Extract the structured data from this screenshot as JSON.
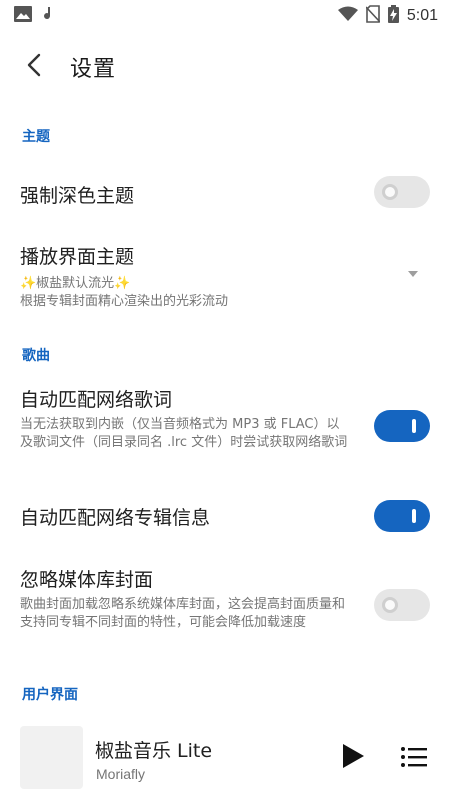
{
  "status_bar": {
    "time": "5:01",
    "icons": [
      "image-icon",
      "music-note-icon",
      "wifi-icon",
      "no-sim-icon",
      "battery-charging-icon"
    ]
  },
  "app_bar": {
    "title": "设置",
    "back_icon": "chevron-left-icon"
  },
  "sections": {
    "theme": "主题",
    "lyrics": "歌曲",
    "ui": "用户界面"
  },
  "prefs": {
    "force_dark": {
      "title": "强制深色主题",
      "enabled": false
    },
    "player_theme": {
      "title": "播放界面主题",
      "value": "✨椒盐默认流光✨",
      "summary": "根据专辑封面精心渲染出的光彩流动"
    },
    "auto_lyrics": {
      "title": "自动匹配网络歌词",
      "summary": "当无法获取到内嵌（仅当音频格式为 MP3 或 FLAC）以及歌词文件（同目录同名 .lrc 文件）时尝试获取网络歌词",
      "enabled": true
    },
    "auto_album": {
      "title": "自动匹配网络专辑信息",
      "enabled": true
    },
    "ignore_cover": {
      "title": "忽略媒体库封面",
      "summary": "歌曲封面加载忽略系统媒体库封面，这会提高封面质量和支持同专辑不同封面的特性，可能会降低加载速度",
      "enabled": false
    }
  },
  "mini_player": {
    "title": "椒盐音乐 Lite",
    "artist": "Moriafly"
  },
  "colors": {
    "accent": "#1565c0",
    "text_primary": "#202020",
    "text_secondary": "#757575"
  }
}
